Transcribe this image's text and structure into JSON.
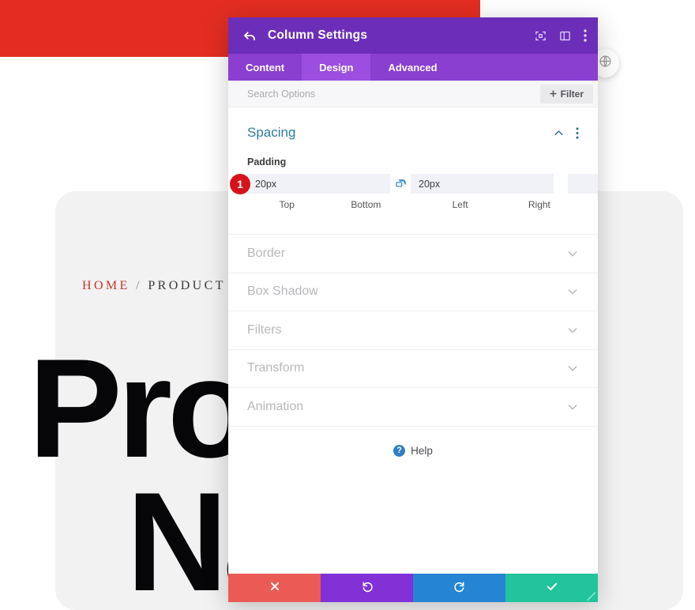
{
  "background": {
    "topbar_color": "#e32d22",
    "breadcrumb": {
      "home": "HOME",
      "separator": " / ",
      "current": "PRODUCT"
    },
    "hero_title_line1": "Product",
    "hero_title_line2": "Name",
    "float_button_icon": "globe-icon"
  },
  "modal": {
    "title": "Column Settings",
    "back_icon": "back-arrow-icon",
    "header_icons": [
      {
        "name": "focus-target-icon"
      },
      {
        "name": "layout-panel-icon"
      },
      {
        "name": "more-options-icon"
      }
    ],
    "header_color": "#6c2eb9",
    "tabs": [
      {
        "label": "Content",
        "active": false
      },
      {
        "label": "Design",
        "active": true
      },
      {
        "label": "Advanced",
        "active": false
      }
    ],
    "search": {
      "placeholder": "Search Options",
      "value": ""
    },
    "filter_button": {
      "label": "Filter",
      "icon": "plus-icon"
    },
    "spacing": {
      "title": "Spacing",
      "collapse_icon": "chevron-up-icon",
      "menu_icon": "more-options-icon",
      "padding_label": "Padding",
      "badge": "1",
      "fields": [
        {
          "caption": "Top",
          "value": "20px",
          "placeholder": ""
        },
        {
          "caption": "Bottom",
          "value": "20px",
          "placeholder": ""
        },
        {
          "caption": "Left",
          "value": "",
          "placeholder": ""
        },
        {
          "caption": "Right",
          "value": "",
          "placeholder": ""
        }
      ],
      "link_top_bottom": {
        "icon": "link-connected-icon",
        "linked": true
      },
      "link_left_right": {
        "icon": "link-broken-icon",
        "linked": false
      }
    },
    "sections": [
      {
        "label": "Border",
        "icon": "chevron-down-icon"
      },
      {
        "label": "Box Shadow",
        "icon": "chevron-down-icon"
      },
      {
        "label": "Filters",
        "icon": "chevron-down-icon"
      },
      {
        "label": "Transform",
        "icon": "chevron-down-icon"
      },
      {
        "label": "Animation",
        "icon": "chevron-down-icon"
      }
    ],
    "help": {
      "label": "Help",
      "icon": "question-mark-icon"
    },
    "footer": [
      {
        "name": "cancel-button",
        "icon": "close-x-icon",
        "color": "#eb5b55"
      },
      {
        "name": "undo-button",
        "icon": "undo-arrow-icon",
        "color": "#8131d6"
      },
      {
        "name": "redo-button",
        "icon": "redo-arrow-icon",
        "color": "#2585d4"
      },
      {
        "name": "save-button",
        "icon": "checkmark-icon",
        "color": "#22c49b"
      }
    ]
  }
}
